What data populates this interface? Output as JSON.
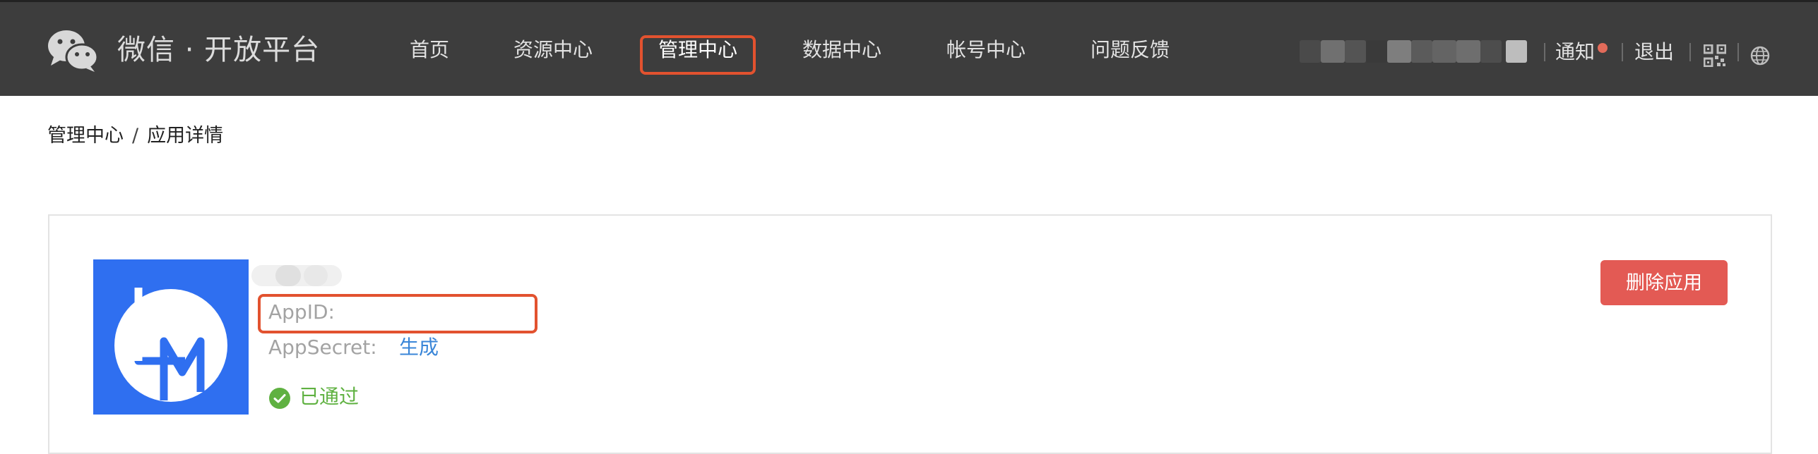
{
  "header": {
    "brand": "微信 · 开放平台",
    "nav": [
      {
        "label": "首页"
      },
      {
        "label": "资源中心"
      },
      {
        "label": "管理中心",
        "active": true
      },
      {
        "label": "数据中心"
      },
      {
        "label": "帐号中心"
      },
      {
        "label": "问题反馈"
      }
    ],
    "notice_label": "通知",
    "logout_label": "退出",
    "icons": [
      "wechat-logo-icon",
      "qr-code-icon",
      "globe-icon"
    ]
  },
  "breadcrumb": {
    "parent": "管理中心",
    "separator": "/",
    "current": "应用详情"
  },
  "app": {
    "appid_label": "AppID:",
    "appsecret_label": "AppSecret:",
    "generate_label": "生成",
    "status_label": "已通过",
    "delete_label": "删除应用"
  },
  "colors": {
    "topbar": "#3d3d3d",
    "highlight": "#e2522f",
    "link": "#3a86d8",
    "success": "#5fb141",
    "danger": "#e35a54",
    "app_icon_bg": "#2f6ff0"
  }
}
